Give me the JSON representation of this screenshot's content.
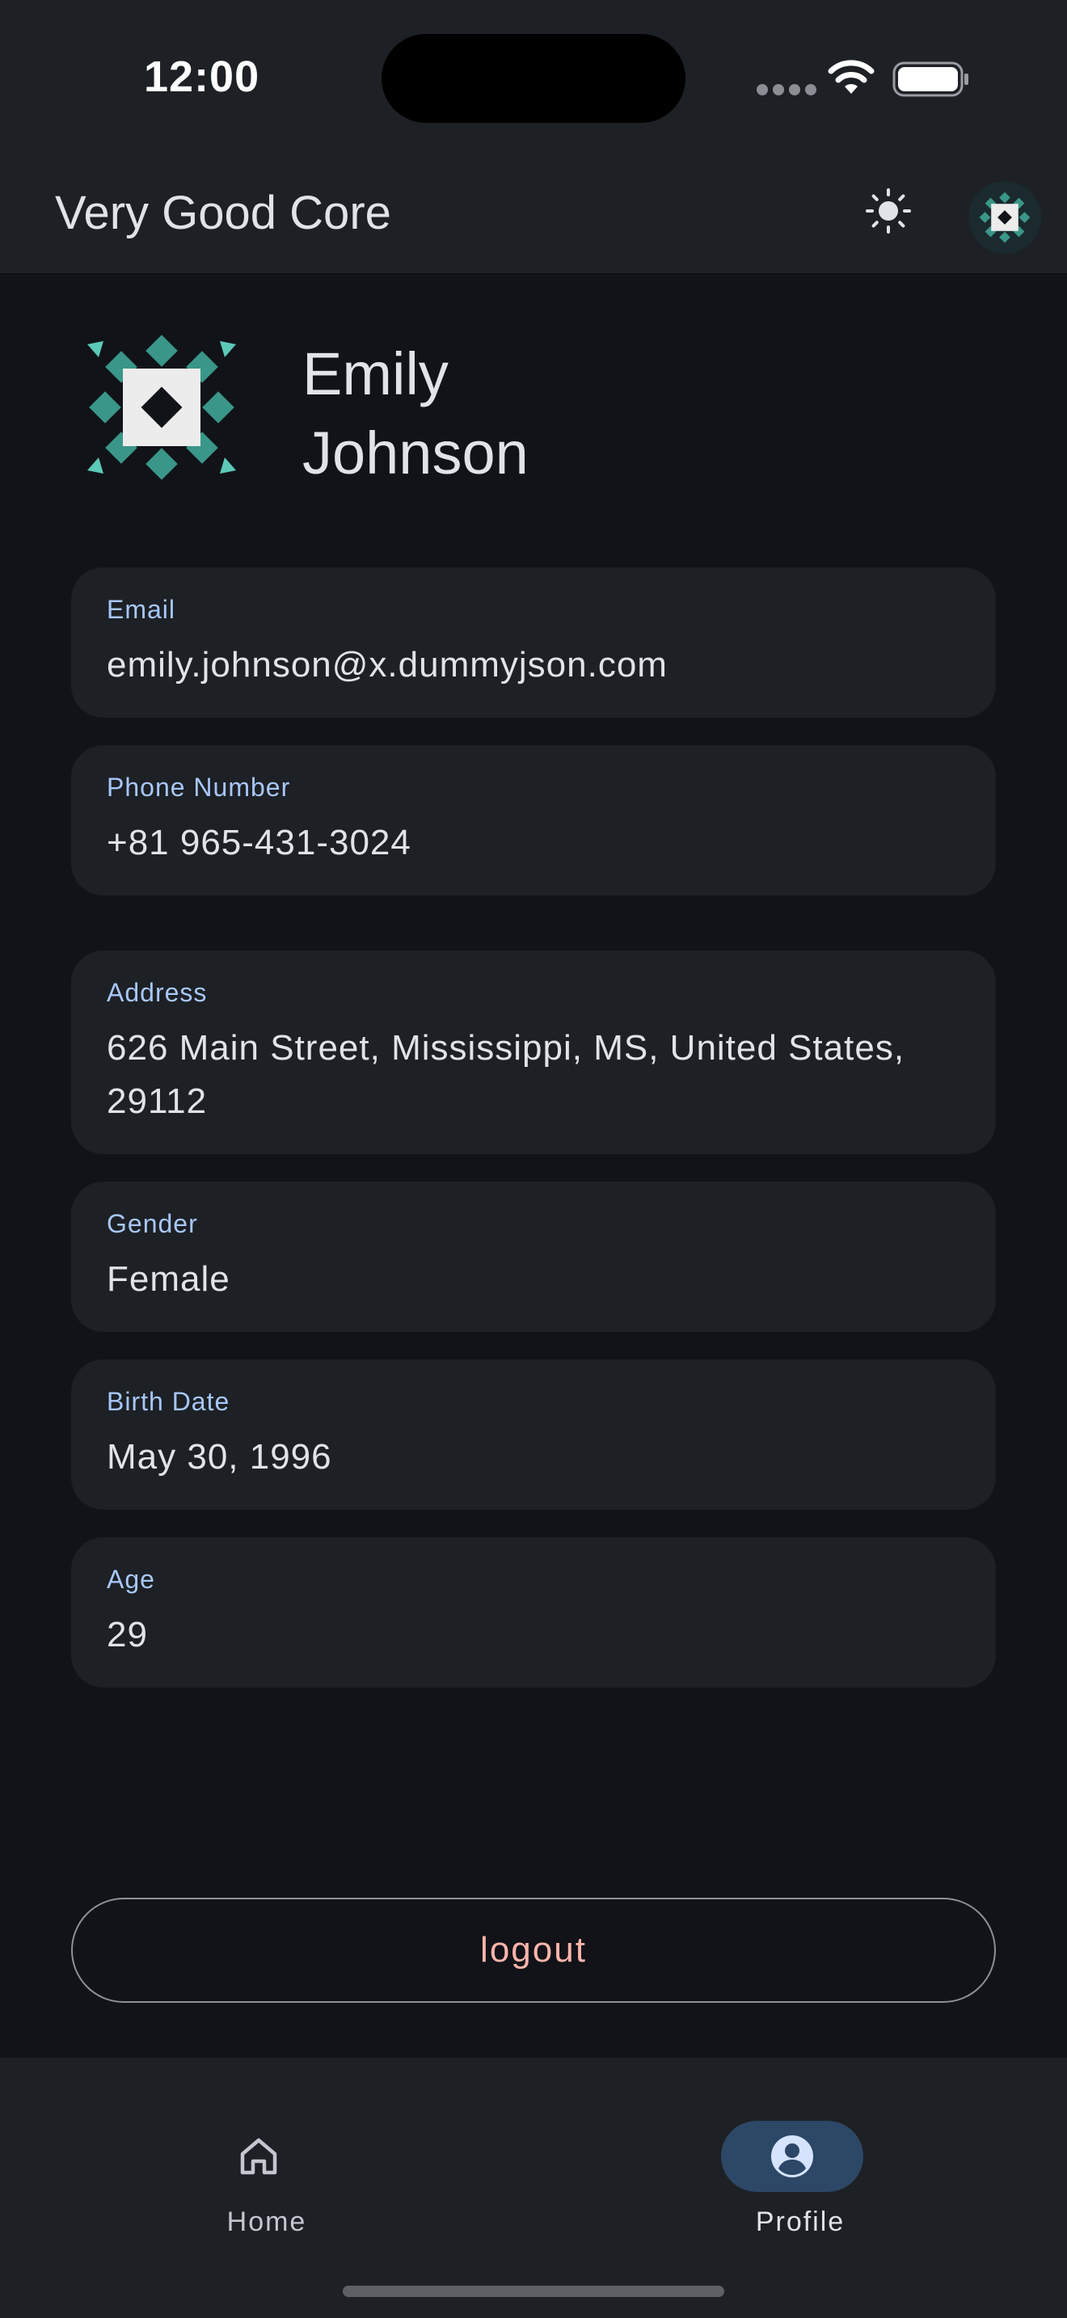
{
  "status_bar": {
    "time": "12:00"
  },
  "app_bar": {
    "title": "Very Good Core",
    "icons": [
      "sun-icon",
      "avatar-icon"
    ]
  },
  "profile": {
    "first_name": "Emily",
    "last_name": "Johnson"
  },
  "fields": [
    {
      "label": "Email",
      "value": "emily.johnson@x.dummyjson.com"
    },
    {
      "label": "Phone Number",
      "value": "+81 965-431-3024"
    },
    {
      "label": "Address",
      "value": "626 Main Street, Mississippi, MS, United States, 29112"
    },
    {
      "label": "Gender",
      "value": "Female"
    },
    {
      "label": "Birth Date",
      "value": "May 30, 1996"
    },
    {
      "label": "Age",
      "value": "29"
    }
  ],
  "actions": {
    "logout_label": "logout"
  },
  "bottom_nav": {
    "items": [
      {
        "label": "Home",
        "icon": "home-icon",
        "selected": false
      },
      {
        "label": "Profile",
        "icon": "account-circle-icon",
        "selected": true
      }
    ]
  },
  "colors": {
    "background": "#111318",
    "surface": "#1d2024",
    "label_accent": "#a8c7fa",
    "logout_text": "#ffb4ab",
    "nav_indicator": "#2d4766",
    "logo_teal": "#3a9688"
  }
}
